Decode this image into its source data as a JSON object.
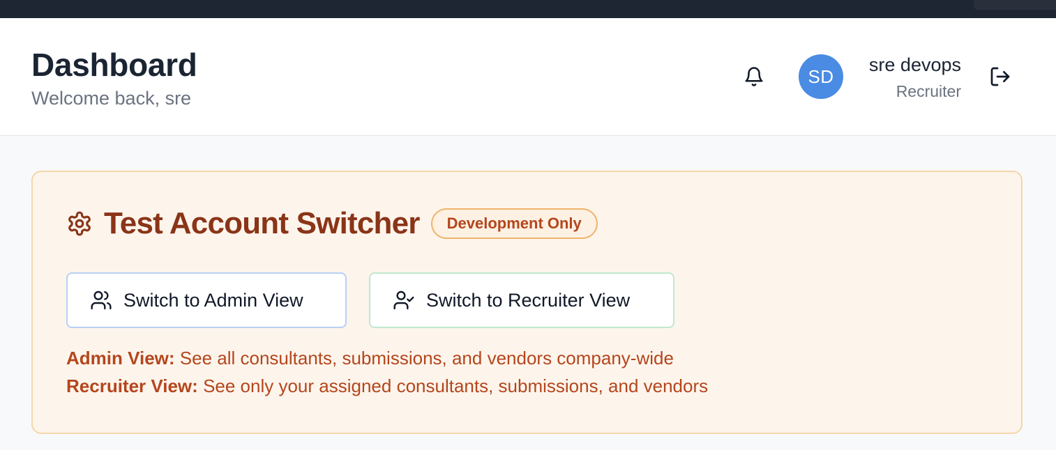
{
  "header": {
    "title": "Dashboard",
    "subtitle": "Welcome back, sre",
    "notification_icon": "bell-icon",
    "user": {
      "initials": "SD",
      "name": "sre devops",
      "role": "Recruiter",
      "avatar_color": "#4a8be3"
    },
    "logout_icon": "log-out-icon"
  },
  "switcher": {
    "icon": "gear-icon",
    "title": "Test Account Switcher",
    "badge": "Development Only",
    "buttons": [
      {
        "label": "Switch to Admin View",
        "icon": "users-icon",
        "border_color": "#b8cff5"
      },
      {
        "label": "Switch to Recruiter View",
        "icon": "user-check-icon",
        "border_color": "#bfe8cd"
      }
    ],
    "descriptions": [
      {
        "label": "Admin View:",
        "text": "See all consultants, submissions, and vendors company-wide"
      },
      {
        "label": "Recruiter View:",
        "text": "See only your assigned consultants, submissions, and vendors"
      }
    ]
  },
  "colors": {
    "accent_text": "#8a3418",
    "description_text": "#b4461d",
    "panel_background": "#fdf5ec",
    "panel_border": "#f4d7a9"
  }
}
